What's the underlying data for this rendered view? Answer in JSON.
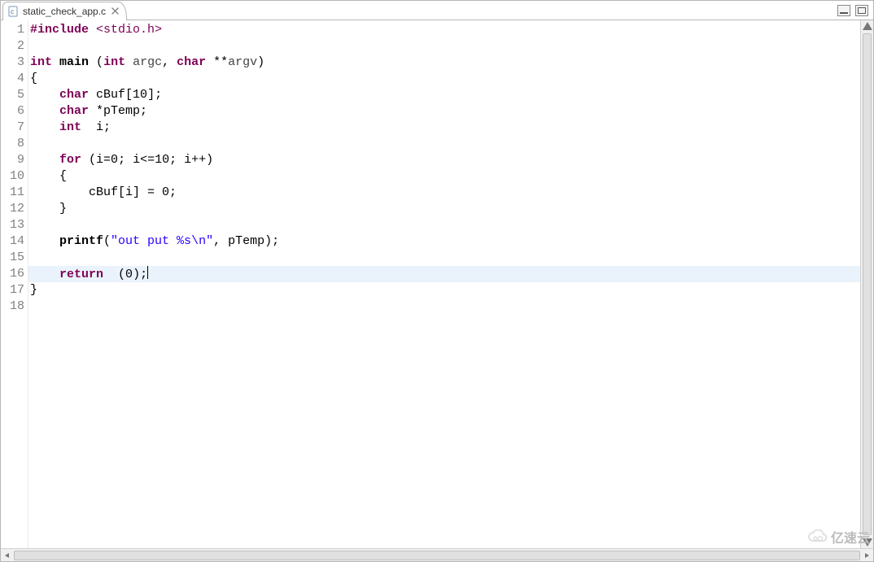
{
  "tab": {
    "filename": "static_check_app.c",
    "close_tooltip": "Close"
  },
  "gutter": {
    "start": 1,
    "end": 18
  },
  "current_line_index": 15,
  "code_lines": [
    [
      {
        "cls": "pp",
        "t": "#include "
      },
      {
        "cls": "inc",
        "t": "<stdio.h>"
      }
    ],
    [],
    [
      {
        "cls": "ty",
        "t": "int"
      },
      {
        "cls": "pn",
        "t": " "
      },
      {
        "cls": "fn",
        "t": "main"
      },
      {
        "cls": "pn",
        "t": " ("
      },
      {
        "cls": "ty",
        "t": "int"
      },
      {
        "cls": "pn",
        "t": " "
      },
      {
        "cls": "arg",
        "t": "argc"
      },
      {
        "cls": "pn",
        "t": ", "
      },
      {
        "cls": "ty",
        "t": "char"
      },
      {
        "cls": "pn",
        "t": " **"
      },
      {
        "cls": "arg",
        "t": "argv"
      },
      {
        "cls": "pn",
        "t": ")"
      }
    ],
    [
      {
        "cls": "pn",
        "t": "{"
      }
    ],
    [
      {
        "cls": "pn",
        "t": "    "
      },
      {
        "cls": "ty",
        "t": "char"
      },
      {
        "cls": "pn",
        "t": " cBuf["
      },
      {
        "cls": "num",
        "t": "10"
      },
      {
        "cls": "pn",
        "t": "];"
      }
    ],
    [
      {
        "cls": "pn",
        "t": "    "
      },
      {
        "cls": "ty",
        "t": "char"
      },
      {
        "cls": "pn",
        "t": " *pTemp;"
      }
    ],
    [
      {
        "cls": "pn",
        "t": "    "
      },
      {
        "cls": "ty",
        "t": "int"
      },
      {
        "cls": "pn",
        "t": "  i;"
      }
    ],
    [],
    [
      {
        "cls": "pn",
        "t": "    "
      },
      {
        "cls": "ty",
        "t": "for"
      },
      {
        "cls": "pn",
        "t": " (i="
      },
      {
        "cls": "num",
        "t": "0"
      },
      {
        "cls": "pn",
        "t": "; i<="
      },
      {
        "cls": "num",
        "t": "10"
      },
      {
        "cls": "pn",
        "t": "; i++)"
      }
    ],
    [
      {
        "cls": "pn",
        "t": "    {"
      }
    ],
    [
      {
        "cls": "pn",
        "t": "        cBuf[i] = "
      },
      {
        "cls": "num",
        "t": "0"
      },
      {
        "cls": "pn",
        "t": ";"
      }
    ],
    [
      {
        "cls": "pn",
        "t": "    }"
      }
    ],
    [],
    [
      {
        "cls": "pn",
        "t": "    "
      },
      {
        "cls": "fn",
        "t": "printf"
      },
      {
        "cls": "pn",
        "t": "("
      },
      {
        "cls": "str",
        "t": "\"out put %s\\n\""
      },
      {
        "cls": "pn",
        "t": ", pTemp);"
      }
    ],
    [],
    [
      {
        "cls": "pn",
        "t": "    "
      },
      {
        "cls": "ty",
        "t": "return"
      },
      {
        "cls": "pn",
        "t": "  ("
      },
      {
        "cls": "num",
        "t": "0"
      },
      {
        "cls": "pn",
        "t": ");"
      },
      {
        "cls": "caret",
        "t": ""
      }
    ],
    [
      {
        "cls": "pn",
        "t": "}"
      }
    ],
    []
  ],
  "watermark_text": "亿速云"
}
